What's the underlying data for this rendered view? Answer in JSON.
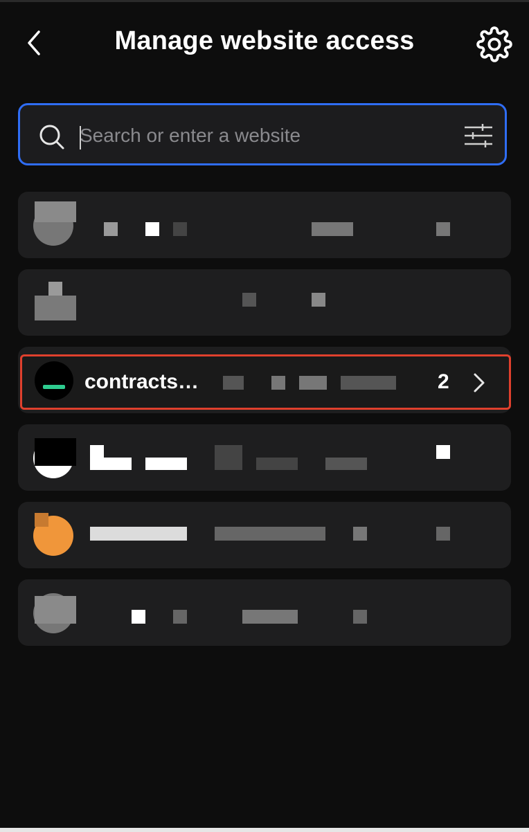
{
  "header": {
    "title": "Manage website access",
    "back_icon": "chevron-left-icon",
    "settings_icon": "gear-icon"
  },
  "search": {
    "placeholder": "Search or enter a website",
    "value": "",
    "search_icon": "search-icon",
    "filter_icon": "sliders-icon"
  },
  "colors": {
    "background": "#0d0d0d",
    "row_background": "#1e1e1f",
    "search_border": "#2f6df5",
    "highlight_border": "#e0402d",
    "active_site_accent": "#2ecc8f"
  },
  "sites": [
    {
      "label": "",
      "redacted": true
    },
    {
      "label": "",
      "redacted": true
    },
    {
      "label": "contracts…",
      "count": "2",
      "highlighted": true
    },
    {
      "label": "",
      "redacted": true
    },
    {
      "label": "",
      "redacted": true
    },
    {
      "label": "",
      "redacted": true
    }
  ]
}
